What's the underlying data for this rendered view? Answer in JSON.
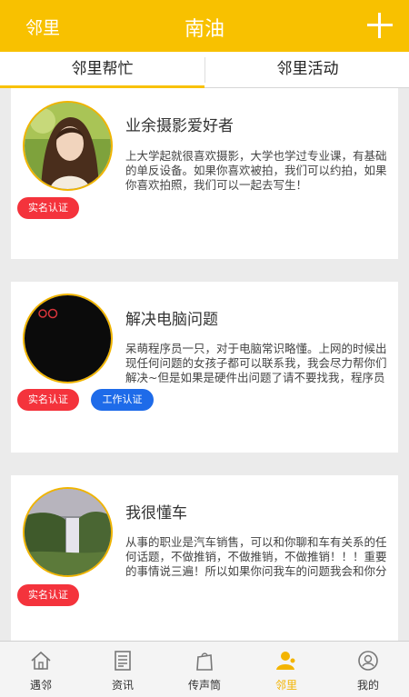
{
  "header": {
    "left_label": "邻里",
    "title": "南油",
    "add_icon": "plus-icon"
  },
  "tabs": [
    {
      "label": "邻里帮忙",
      "active": true
    },
    {
      "label": "邻里活动",
      "active": false
    }
  ],
  "cards": [
    {
      "title": "业余摄影爱好者",
      "description": "上大学起就很喜欢摄影，大学也学过专业课，有基础的单反设备。如果你喜欢被拍，我们可以约拍，如果你喜欢拍照，我们可以一起去写生！",
      "badges": [
        "实名认证"
      ]
    },
    {
      "title": "解决电脑问题",
      "description": "呆萌程序员一只，对于电脑常识略懂。上网的时候出现任何问题的女孩子都可以联系我，我会尽力帮你们解决~但是如果是硬件出问题了请不要找我，程序员",
      "badges": [
        "实名认证",
        "工作认证"
      ]
    },
    {
      "title": "我很懂车",
      "description": "从事的职业是汽车销售，可以和你聊和车有关系的任何话题，不做推销，不做推销，不做推销！！！重要的事情说三遍！所以如果你问我车的问题我会和你分",
      "badges": [
        "实名认证"
      ]
    }
  ],
  "colors": {
    "accent": "#f8c100",
    "badge_red": "#f4333c",
    "badge_blue": "#1e6be9"
  },
  "bottom_nav": [
    {
      "label": "遇邻",
      "icon": "house-icon",
      "active": false
    },
    {
      "label": "资讯",
      "icon": "newspaper-icon",
      "active": false
    },
    {
      "label": "传声筒",
      "icon": "shopping-bag-icon",
      "active": false
    },
    {
      "label": "邻里",
      "icon": "person-icon",
      "active": true
    },
    {
      "label": "我的",
      "icon": "user-circle-icon",
      "active": false
    }
  ]
}
